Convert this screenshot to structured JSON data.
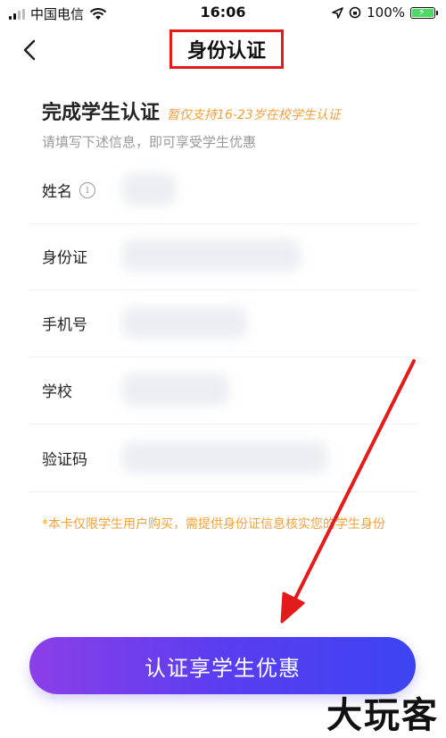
{
  "status_bar": {
    "carrier": "中国电信",
    "time": "16:06",
    "battery": "100%"
  },
  "nav": {
    "title": "身份认证"
  },
  "form": {
    "title": "完成学生认证",
    "note": "暂仅支持16-23岁在校学生认证",
    "subtitle": "请填写下述信息，即可享受学生优惠",
    "fields": [
      {
        "label": "姓名",
        "info": "i"
      },
      {
        "label": "身份证"
      },
      {
        "label": "手机号"
      },
      {
        "label": "学校"
      },
      {
        "label": "验证码"
      }
    ],
    "disclaimer": "*本卡仅限学生用户购买，需提供身份证信息核实您的学生身份"
  },
  "submit": {
    "label": "认证享学生优惠"
  },
  "watermark": "大玩客",
  "colors": {
    "title_highlight": "#e31b1b",
    "note": "#f0a13a",
    "button_start": "#8b3fe8",
    "button_end": "#3c44f2",
    "battery": "#4cd964"
  }
}
